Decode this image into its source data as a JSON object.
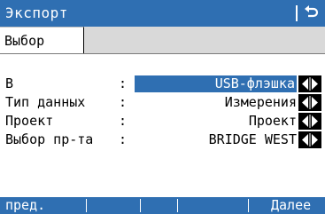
{
  "window": {
    "title": "Экспорт"
  },
  "tabs": [
    {
      "label": "Выбор"
    }
  ],
  "fields": [
    {
      "label": "В",
      "value": "USB-флэшка"
    },
    {
      "label": "Тип данных",
      "value": "Измерения"
    },
    {
      "label": "Проект",
      "value": "Проект"
    },
    {
      "label": "Выбор пр-та",
      "value": "BRIDGE WEST"
    }
  ],
  "softkeys": {
    "f1": "пред.",
    "f2": "",
    "f3": "",
    "f4": "",
    "f5": "",
    "f6": "Далее"
  },
  "colors": {
    "accent": "#2f6fb2",
    "tab_strip": "#d9d9d9"
  }
}
